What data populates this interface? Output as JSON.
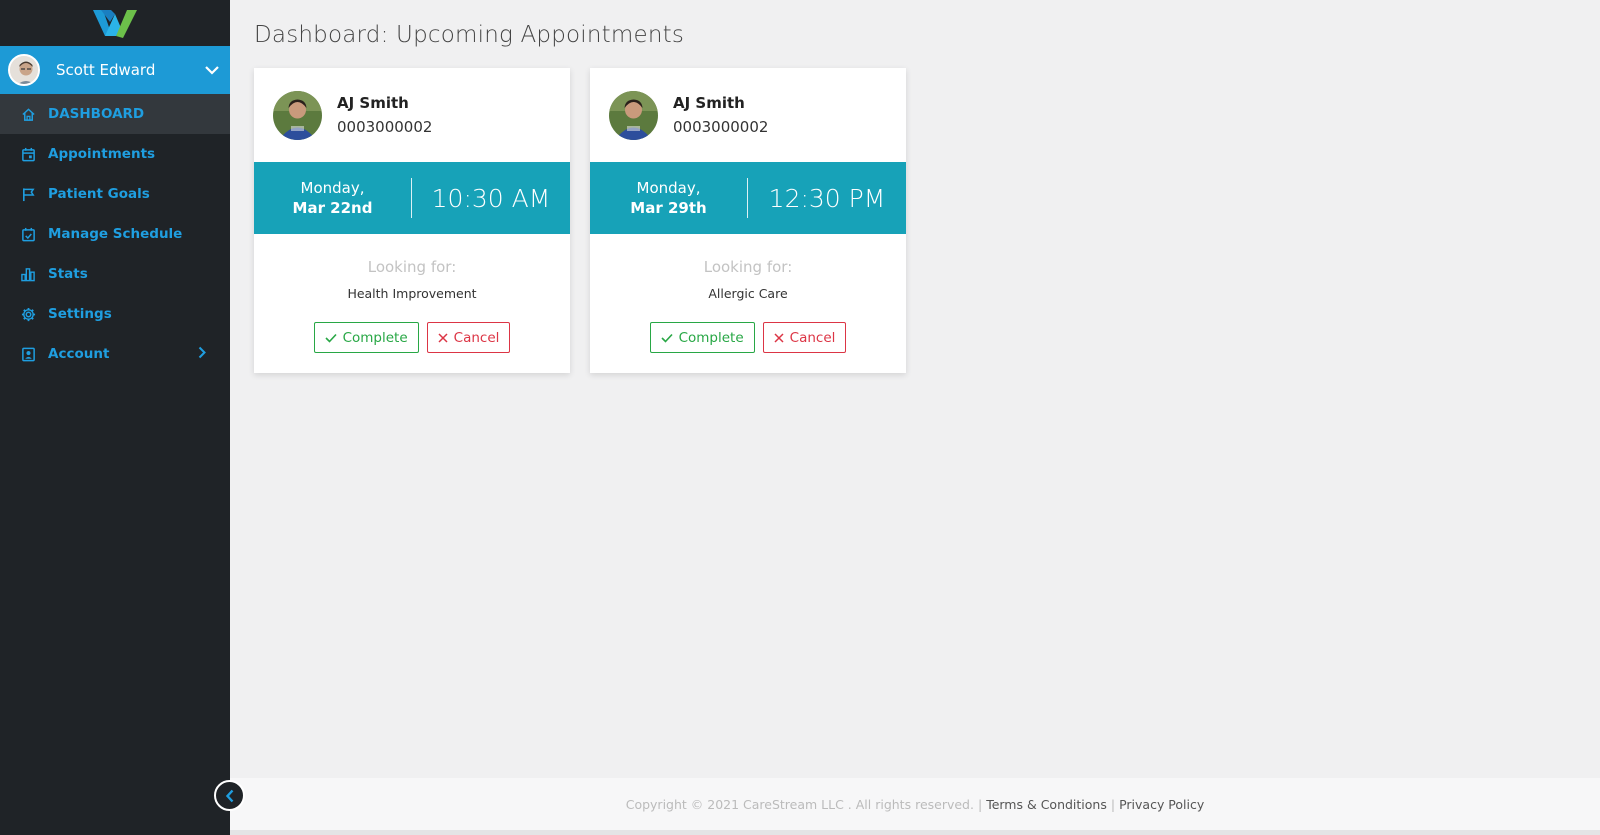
{
  "colors": {
    "sidebar_bg": "#1f2327",
    "accent": "#1d9ad6",
    "band": "#17a2b8",
    "complete": "#28a745",
    "cancel": "#dc3545"
  },
  "sidebar": {
    "user": {
      "name": "Scott Edward"
    },
    "items": [
      {
        "label": "DASHBOARD",
        "icon": "home-icon",
        "active": true
      },
      {
        "label": "Appointments",
        "icon": "calendar-icon"
      },
      {
        "label": "Patient Goals",
        "icon": "flag-icon"
      },
      {
        "label": "Manage Schedule",
        "icon": "calendar-check-icon"
      },
      {
        "label": "Stats",
        "icon": "bar-chart-icon"
      },
      {
        "label": "Settings",
        "icon": "gear-icon"
      },
      {
        "label": "Account",
        "icon": "account-icon",
        "has_submenu": true
      }
    ]
  },
  "page": {
    "title": "Dashboard: Upcoming Appointments"
  },
  "appointments": [
    {
      "patient_name": "AJ Smith",
      "patient_id": "0003000002",
      "day": "Monday,",
      "date": "Mar 22nd",
      "time": "10:30 AM",
      "looking_label": "Looking for:",
      "looking_value": "Health Improvement",
      "complete_label": "Complete",
      "cancel_label": "Cancel"
    },
    {
      "patient_name": "AJ Smith",
      "patient_id": "0003000002",
      "day": "Monday,",
      "date": "Mar 29th",
      "time": "12:30 PM",
      "looking_label": "Looking for:",
      "looking_value": "Allergic Care",
      "complete_label": "Complete",
      "cancel_label": "Cancel"
    }
  ],
  "footer": {
    "copyright": "Copyright © 2021 CareStream LLC . All rights reserved.",
    "separator": "|",
    "terms": "Terms & Conditions",
    "privacy": "Privacy Policy"
  }
}
